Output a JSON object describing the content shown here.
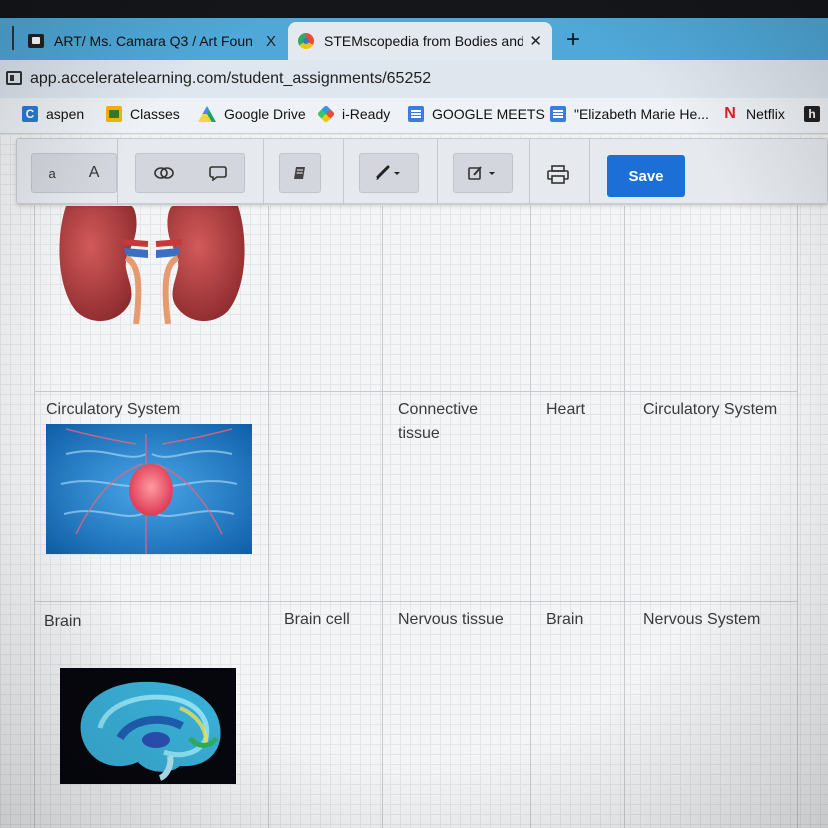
{
  "browser": {
    "tabs": [
      {
        "label": "ART/ Ms. Camara Q3 / Art Foun",
        "close": "X"
      },
      {
        "label": "STEMscopedia from Bodies and",
        "close": "✕"
      }
    ],
    "new_tab": "+",
    "url": "app.acceleratelearning.com/student_assignments/65252"
  },
  "bookmarks": [
    {
      "label": "aspen",
      "icon": "C"
    },
    {
      "label": "Classes"
    },
    {
      "label": "Google Drive"
    },
    {
      "label": "i-Ready"
    },
    {
      "label": "GOOGLE MEETS"
    },
    {
      "label": "\"Elizabeth Marie He..."
    },
    {
      "label": "Netflix",
      "icon": "N"
    },
    {
      "icon": "h"
    }
  ],
  "toolbar": {
    "font_small": "a",
    "font_large": "A",
    "save_label": "Save"
  },
  "table": {
    "rows": [
      {
        "col1": "",
        "col2": "",
        "col3": "",
        "col4": "",
        "col5": ""
      },
      {
        "col1": "Circulatory System",
        "col2": "",
        "col3": "Connective tissue",
        "col4": "Heart",
        "col5": "Circulatory System"
      },
      {
        "col1": "Brain",
        "col2": "Brain cell",
        "col3": "Nervous tissue",
        "col4": "Brain",
        "col5": "Nervous System"
      }
    ]
  },
  "colors": {
    "tab_strip": "#4fa8d8",
    "save_button": "#1b6fd6"
  }
}
